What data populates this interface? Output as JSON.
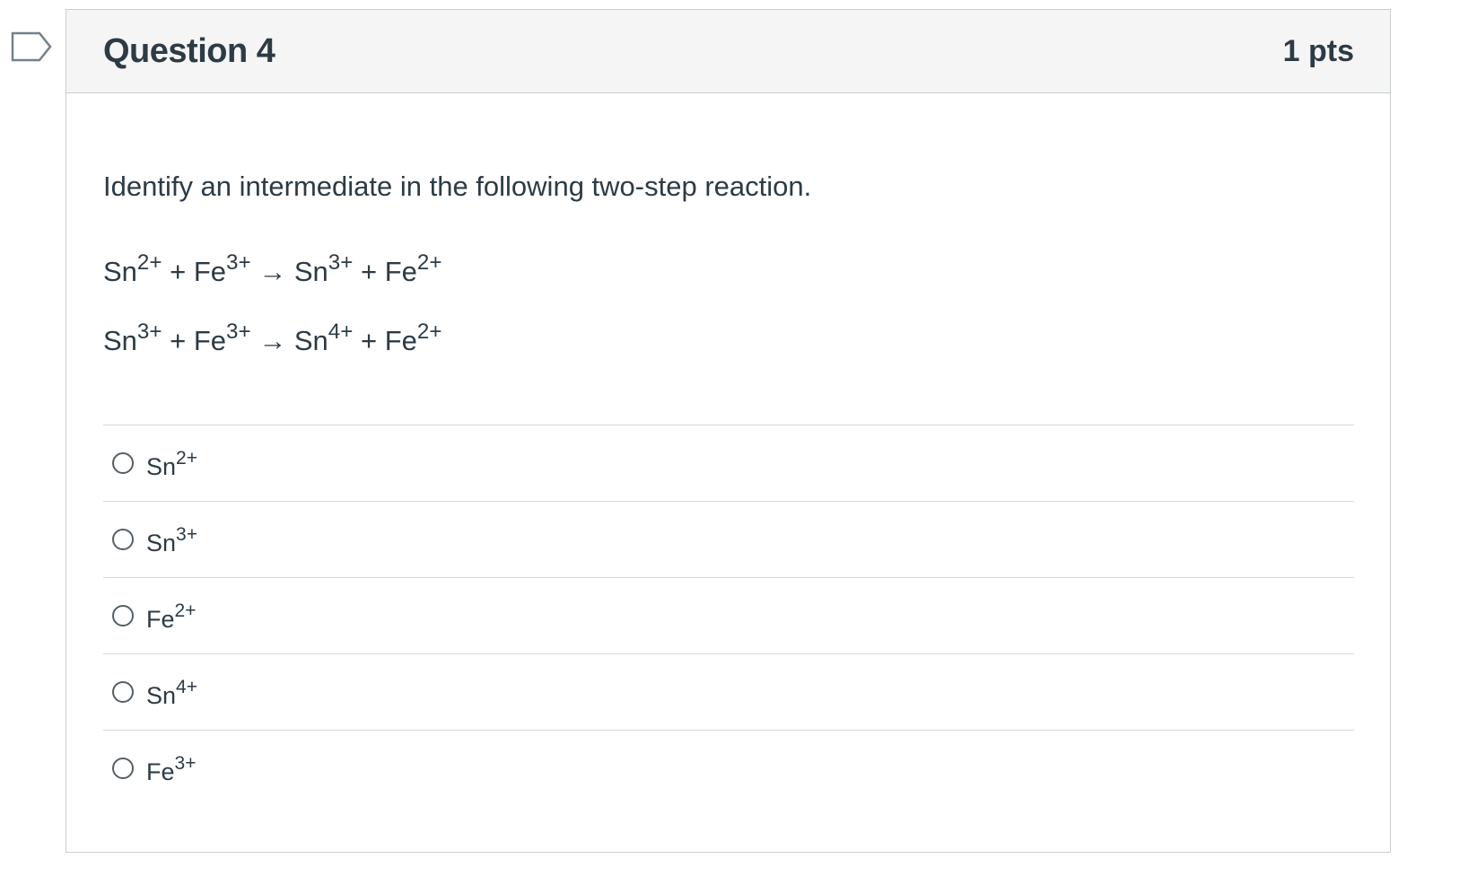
{
  "question": {
    "title": "Question 4",
    "points": "1 pts",
    "prompt": "Identify an intermediate in the following two-step reaction.",
    "equations": [
      {
        "r1": "Sn",
        "r1_charge": "2+",
        "plus1": "+",
        "r2": "Fe",
        "r2_charge": "3+",
        "arrow": "→",
        "p1": "Sn",
        "p1_charge": "3+",
        "plus2": "+",
        "p2": "Fe",
        "p2_charge": "2+"
      },
      {
        "r1": "Sn",
        "r1_charge": "3+",
        "plus1": "+",
        "r2": "Fe",
        "r2_charge": "3+",
        "arrow": "→",
        "p1": "Sn",
        "p1_charge": "4+",
        "plus2": "+",
        "p2": "Fe",
        "p2_charge": "2+"
      }
    ],
    "answers": [
      {
        "symbol": "Sn",
        "charge": "2+"
      },
      {
        "symbol": "Sn",
        "charge": "3+"
      },
      {
        "symbol": "Fe",
        "charge": "2+"
      },
      {
        "symbol": "Sn",
        "charge": "4+"
      },
      {
        "symbol": "Fe",
        "charge": "3+"
      }
    ]
  },
  "icons": {
    "flag": "flag-bookmark-icon"
  },
  "colors": {
    "text": "#2d3b45",
    "header_bg": "#f5f5f5",
    "border": "#c7cdd1",
    "flag": "#73818c"
  }
}
